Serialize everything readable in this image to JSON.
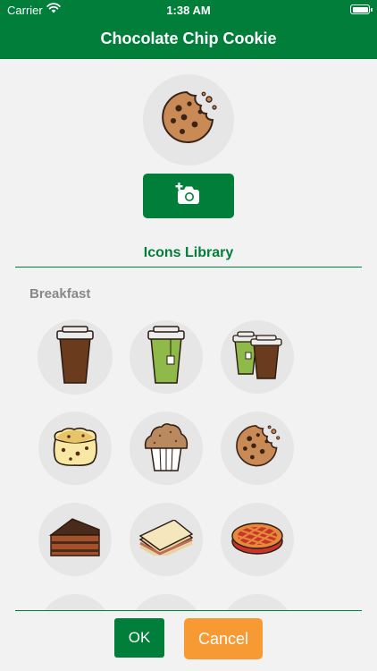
{
  "status_bar": {
    "carrier": "Carrier",
    "time": "1:38 AM"
  },
  "nav": {
    "title": "Chocolate Chip Cookie"
  },
  "selected_icon": {
    "icon": "cookie-icon"
  },
  "camera_button": {
    "icon": "add-photo-camera-icon"
  },
  "library": {
    "title": "Icons Library"
  },
  "category": {
    "label": "Breakfast",
    "icons": [
      {
        "icon": "coffee-cup-icon",
        "selected": true
      },
      {
        "icon": "green-tea-cup-icon",
        "selected": false
      },
      {
        "icon": "tea-and-coffee-cups-icon",
        "selected": false
      },
      {
        "icon": "scone-icon",
        "selected": false
      },
      {
        "icon": "muffin-icon",
        "selected": false
      },
      {
        "icon": "cookie-icon",
        "selected": false
      },
      {
        "icon": "chocolate-cake-slice-icon",
        "selected": false
      },
      {
        "icon": "sandwich-icon",
        "selected": false
      },
      {
        "icon": "pie-icon",
        "selected": false
      }
    ]
  },
  "actions": {
    "ok_label": "OK",
    "cancel_label": "Cancel"
  },
  "colors": {
    "primary": "#007e3a",
    "accent": "#f89a34",
    "background": "#f2f2f2",
    "circle": "#e6e6e6"
  }
}
